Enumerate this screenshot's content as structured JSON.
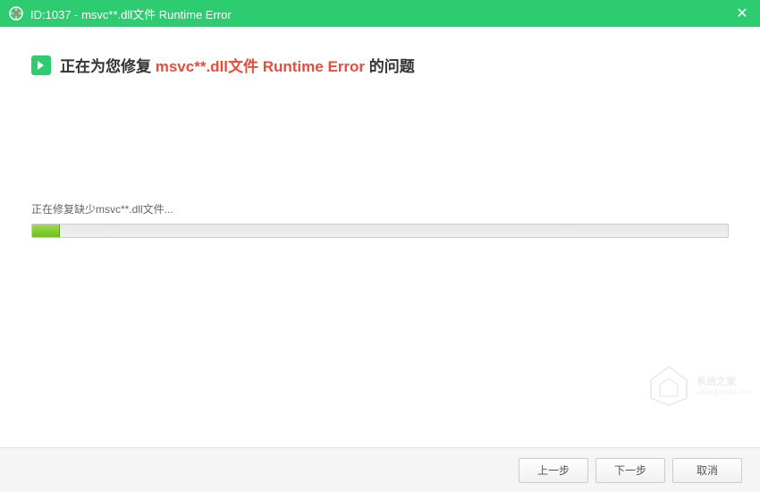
{
  "titlebar": {
    "title": "ID:1037 - msvc**.dll文件 Runtime Error"
  },
  "heading": {
    "prefix": "正在为您修复 ",
    "highlight": "msvc**.dll文件 Runtime Error",
    "suffix": " 的问题"
  },
  "progress": {
    "label": "正在修复缺少msvc**.dll文件...",
    "percent": 4
  },
  "footer": {
    "prev": "上一步",
    "next": "下一步",
    "cancel": "取消"
  },
  "watermark": {
    "name": "系统之家",
    "sub": "xitongzhijia.net"
  }
}
